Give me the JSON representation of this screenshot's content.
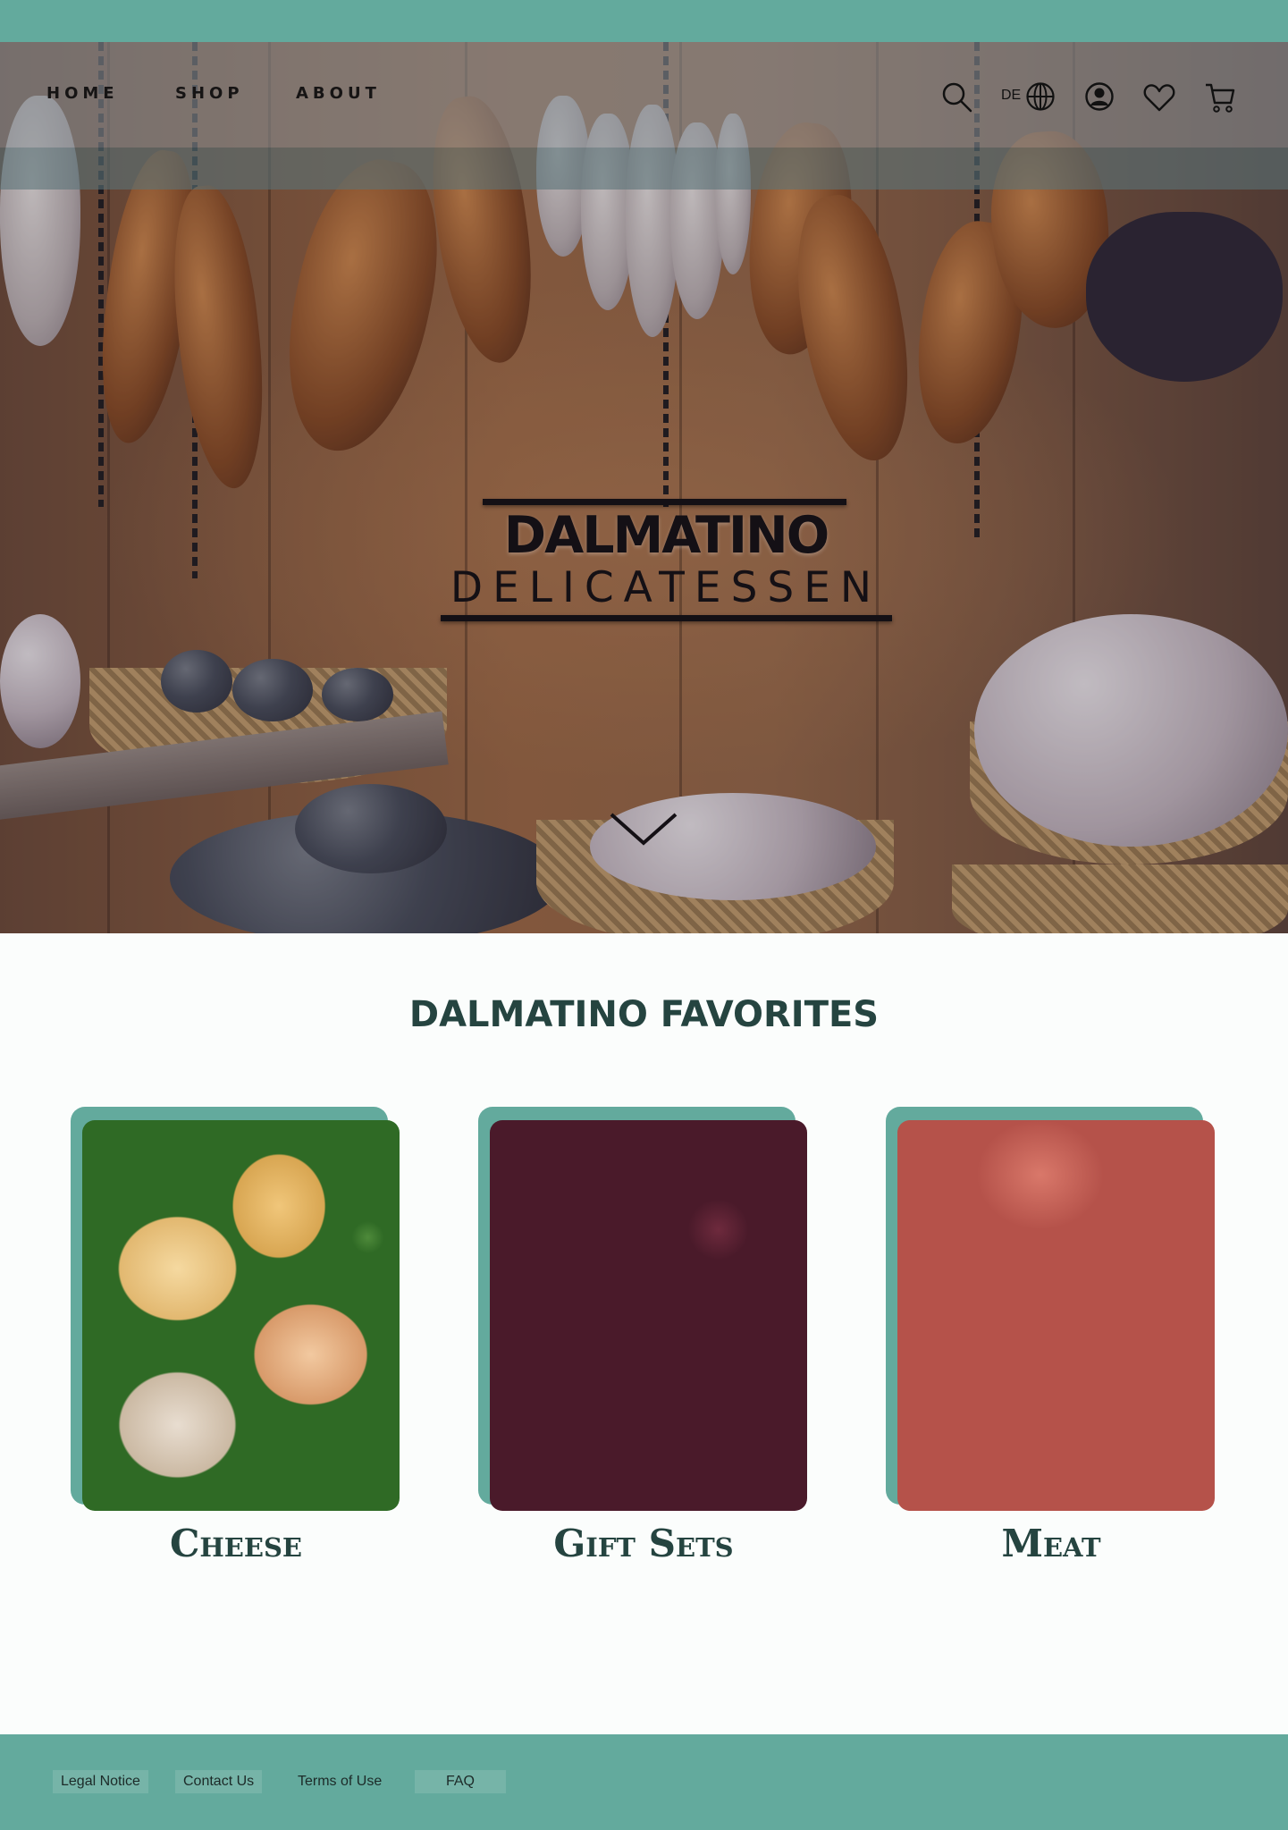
{
  "nav": {
    "home": "HOME",
    "shop": "SHOP",
    "about": "ABOUT",
    "language": "DE",
    "icons": [
      "search-icon",
      "globe-icon",
      "account-icon",
      "heart-icon",
      "cart-icon"
    ]
  },
  "hero": {
    "title": "DALMATINO",
    "subtitle": "DELICATESSEN"
  },
  "favorites": {
    "title": "DALMATINO FAVORITES",
    "cards": [
      {
        "label": "Cheese"
      },
      {
        "label": "Gift Sets"
      },
      {
        "label": "Meat"
      }
    ]
  },
  "footer": {
    "links": [
      "Legal Notice",
      "Contact Us",
      "Terms of Use",
      "FAQ"
    ]
  },
  "colors": {
    "accent": "#63aa9d",
    "heading": "#254440",
    "background": "#fbfdfc"
  }
}
